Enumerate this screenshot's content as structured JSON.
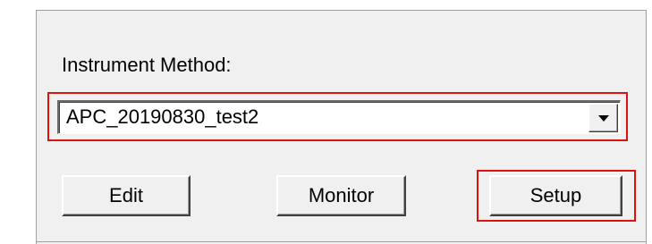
{
  "instrument_method": {
    "label": "Instrument Method:",
    "selected_value": "APC_20190830_test2"
  },
  "buttons": {
    "edit_label": "Edit",
    "monitor_label": "Monitor",
    "setup_label": "Setup"
  },
  "colors": {
    "panel_background": "#f0f0f0",
    "highlight": "#e01010"
  },
  "icons": {
    "dropdown": "chevron-down-icon"
  }
}
